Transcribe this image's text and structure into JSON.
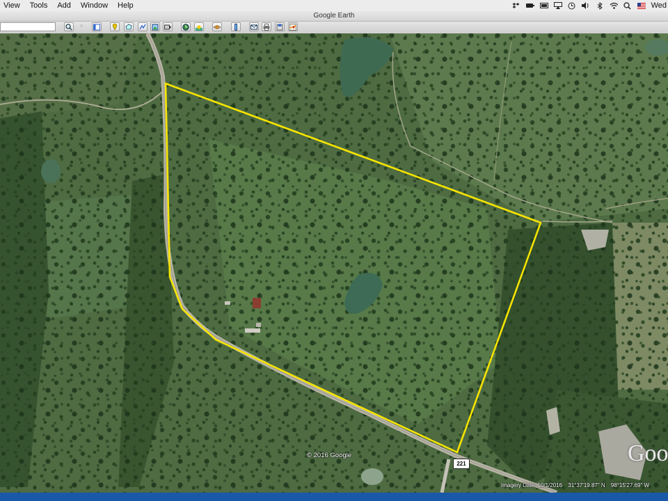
{
  "menubar": {
    "items": [
      {
        "label": "View"
      },
      {
        "label": "Tools"
      },
      {
        "label": "Add"
      },
      {
        "label": "Window"
      },
      {
        "label": "Help"
      }
    ],
    "status_icons": [
      "dropbox-icon",
      "battery-status-icon",
      "display-icon",
      "airplay-icon",
      "time-machine-icon",
      "volume-icon",
      "bluetooth-icon",
      "wifi-icon",
      "spotlight-icon",
      "language-flag-icon"
    ],
    "clock": "Wed"
  },
  "window": {
    "title": "Google Earth"
  },
  "toolbar": {
    "search_value": "",
    "buttons": [
      {
        "name": "search-icon",
        "glyph": "🔍"
      },
      {
        "name": "sidebar-toggle-icon",
        "glyph": "▤"
      },
      {
        "name": "placemark-icon",
        "glyph": "📌"
      },
      {
        "name": "polygon-icon",
        "glyph": "⬠"
      },
      {
        "name": "path-icon",
        "glyph": "〰"
      },
      {
        "name": "image-overlay-icon",
        "glyph": "▧"
      },
      {
        "name": "record-tour-icon",
        "glyph": "◉"
      },
      {
        "name": "historical-imagery-icon",
        "glyph": "🕘"
      },
      {
        "name": "sunlight-icon",
        "glyph": "☀"
      },
      {
        "name": "planets-icon",
        "glyph": "🪐"
      },
      {
        "name": "ruler-icon",
        "glyph": "📏"
      },
      {
        "name": "email-icon",
        "glyph": "✉"
      },
      {
        "name": "print-icon",
        "glyph": "🖨"
      },
      {
        "name": "google-maps-icon",
        "glyph": "🗺"
      }
    ]
  },
  "map": {
    "copyright": "© 2016 Google",
    "highway_shield": "221",
    "imagery_date": "Imagery Date: 10/1/2016",
    "latitude": "31°37'19.87\" N",
    "longitude": "98°15'27.69\" W",
    "logo": "Goo",
    "boundary_color": "#f5e300"
  }
}
